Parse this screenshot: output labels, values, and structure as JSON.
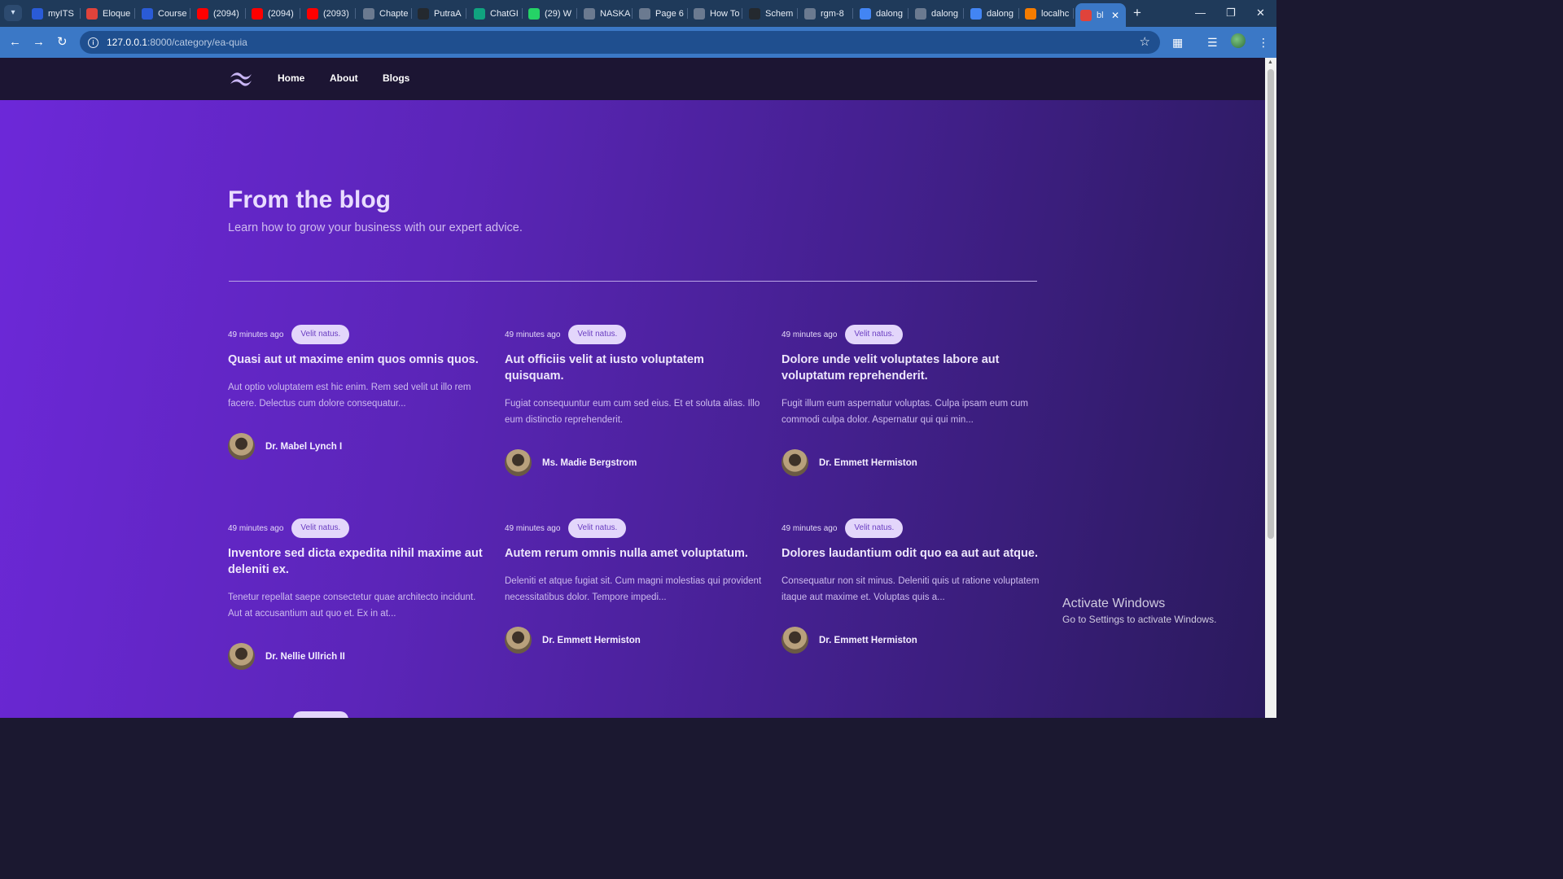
{
  "browser": {
    "tabs": [
      {
        "label": "myITS",
        "icon": "its-icon",
        "color": "#2a5bd7"
      },
      {
        "label": "Eloque",
        "icon": "eloquent-icon",
        "color": "#e0433b"
      },
      {
        "label": "Course",
        "icon": "its-icon",
        "color": "#2a5bd7"
      },
      {
        "label": "(2094)",
        "icon": "youtube-icon",
        "color": "#ff0000"
      },
      {
        "label": "(2094)",
        "icon": "youtube-icon",
        "color": "#ff0000"
      },
      {
        "label": "(2093)",
        "icon": "youtube-icon",
        "color": "#ff0000"
      },
      {
        "label": "Chapte",
        "icon": "globe-icon",
        "color": "#6b7a90"
      },
      {
        "label": "PutraA",
        "icon": "github-icon",
        "color": "#24292f"
      },
      {
        "label": "ChatGI",
        "icon": "chatgpt-icon",
        "color": "#10a37f"
      },
      {
        "label": "(29) W",
        "icon": "whatsapp-icon",
        "color": "#25d366"
      },
      {
        "label": "NASKA",
        "icon": "globe-icon",
        "color": "#6b7a90"
      },
      {
        "label": "Page 6",
        "icon": "globe-icon",
        "color": "#6b7a90"
      },
      {
        "label": "How To",
        "icon": "globe-icon",
        "color": "#6b7a90"
      },
      {
        "label": "Schem",
        "icon": "github-icon",
        "color": "#24292f"
      },
      {
        "label": "rgm-8",
        "icon": "globe-icon",
        "color": "#6b7a90"
      },
      {
        "label": "dalong",
        "icon": "google-icon",
        "color": "#4285f4"
      },
      {
        "label": "dalong",
        "icon": "globe-icon",
        "color": "#6b7a90"
      },
      {
        "label": "dalong",
        "icon": "google-icon",
        "color": "#4285f4"
      },
      {
        "label": "localhc",
        "icon": "xampp-icon",
        "color": "#f57c00"
      },
      {
        "label": "bl",
        "icon": "laravel-icon",
        "color": "#e0433b",
        "active": true
      }
    ],
    "url_host": "127.0.0.1",
    "url_path": ":8000/category/ea-quia"
  },
  "site": {
    "nav": [
      {
        "label": "Home"
      },
      {
        "label": "About"
      },
      {
        "label": "Blogs"
      }
    ],
    "hero_title": "From the blog",
    "hero_subtitle": "Learn how to grow your business with our expert advice."
  },
  "posts": [
    {
      "date": "49 minutes ago",
      "category": "Velit natus.",
      "title": "Quasi aut ut maxime enim quos omnis quos.",
      "excerpt": "Aut optio voluptatem est hic enim. Rem sed velit ut illo rem facere. Delectus cum dolore consequatur...",
      "author": "Dr. Mabel Lynch I"
    },
    {
      "date": "49 minutes ago",
      "category": "Velit natus.",
      "title": "Aut officiis velit at iusto voluptatem quisquam.",
      "excerpt": "Fugiat consequuntur eum cum sed eius. Et et soluta alias. Illo eum distinctio reprehenderit.",
      "author": "Ms. Madie Bergstrom"
    },
    {
      "date": "49 minutes ago",
      "category": "Velit natus.",
      "title": "Dolore unde velit voluptates labore aut voluptatum reprehenderit.",
      "excerpt": "Fugit illum eum aspernatur voluptas. Culpa ipsam eum cum commodi culpa dolor. Aspernatur qui qui min...",
      "author": "Dr. Emmett Hermiston"
    },
    {
      "date": "49 minutes ago",
      "category": "Velit natus.",
      "title": "Inventore sed dicta expedita nihil maxime aut deleniti ex.",
      "excerpt": "Tenetur repellat saepe consectetur quae architecto incidunt. Aut at accusantium aut quo et. Ex in at...",
      "author": "Dr. Nellie Ullrich II"
    },
    {
      "date": "49 minutes ago",
      "category": "Velit natus.",
      "title": "Autem rerum omnis nulla amet voluptatum.",
      "excerpt": "Deleniti et atque fugiat sit. Cum magni molestias qui provident necessitatibus dolor. Tempore impedi...",
      "author": "Dr. Emmett Hermiston"
    },
    {
      "date": "49 minutes ago",
      "category": "Velit natus.",
      "title": "Dolores laudantium odit quo ea aut aut atque.",
      "excerpt": "Consequatur non sit minus. Deleniti quis ut ratione voluptatem itaque aut maxime et. Voluptas quis a...",
      "author": "Dr. Emmett Hermiston"
    }
  ],
  "os_watermark": {
    "title": "Activate Windows",
    "subtitle": "Go to Settings to activate Windows."
  }
}
